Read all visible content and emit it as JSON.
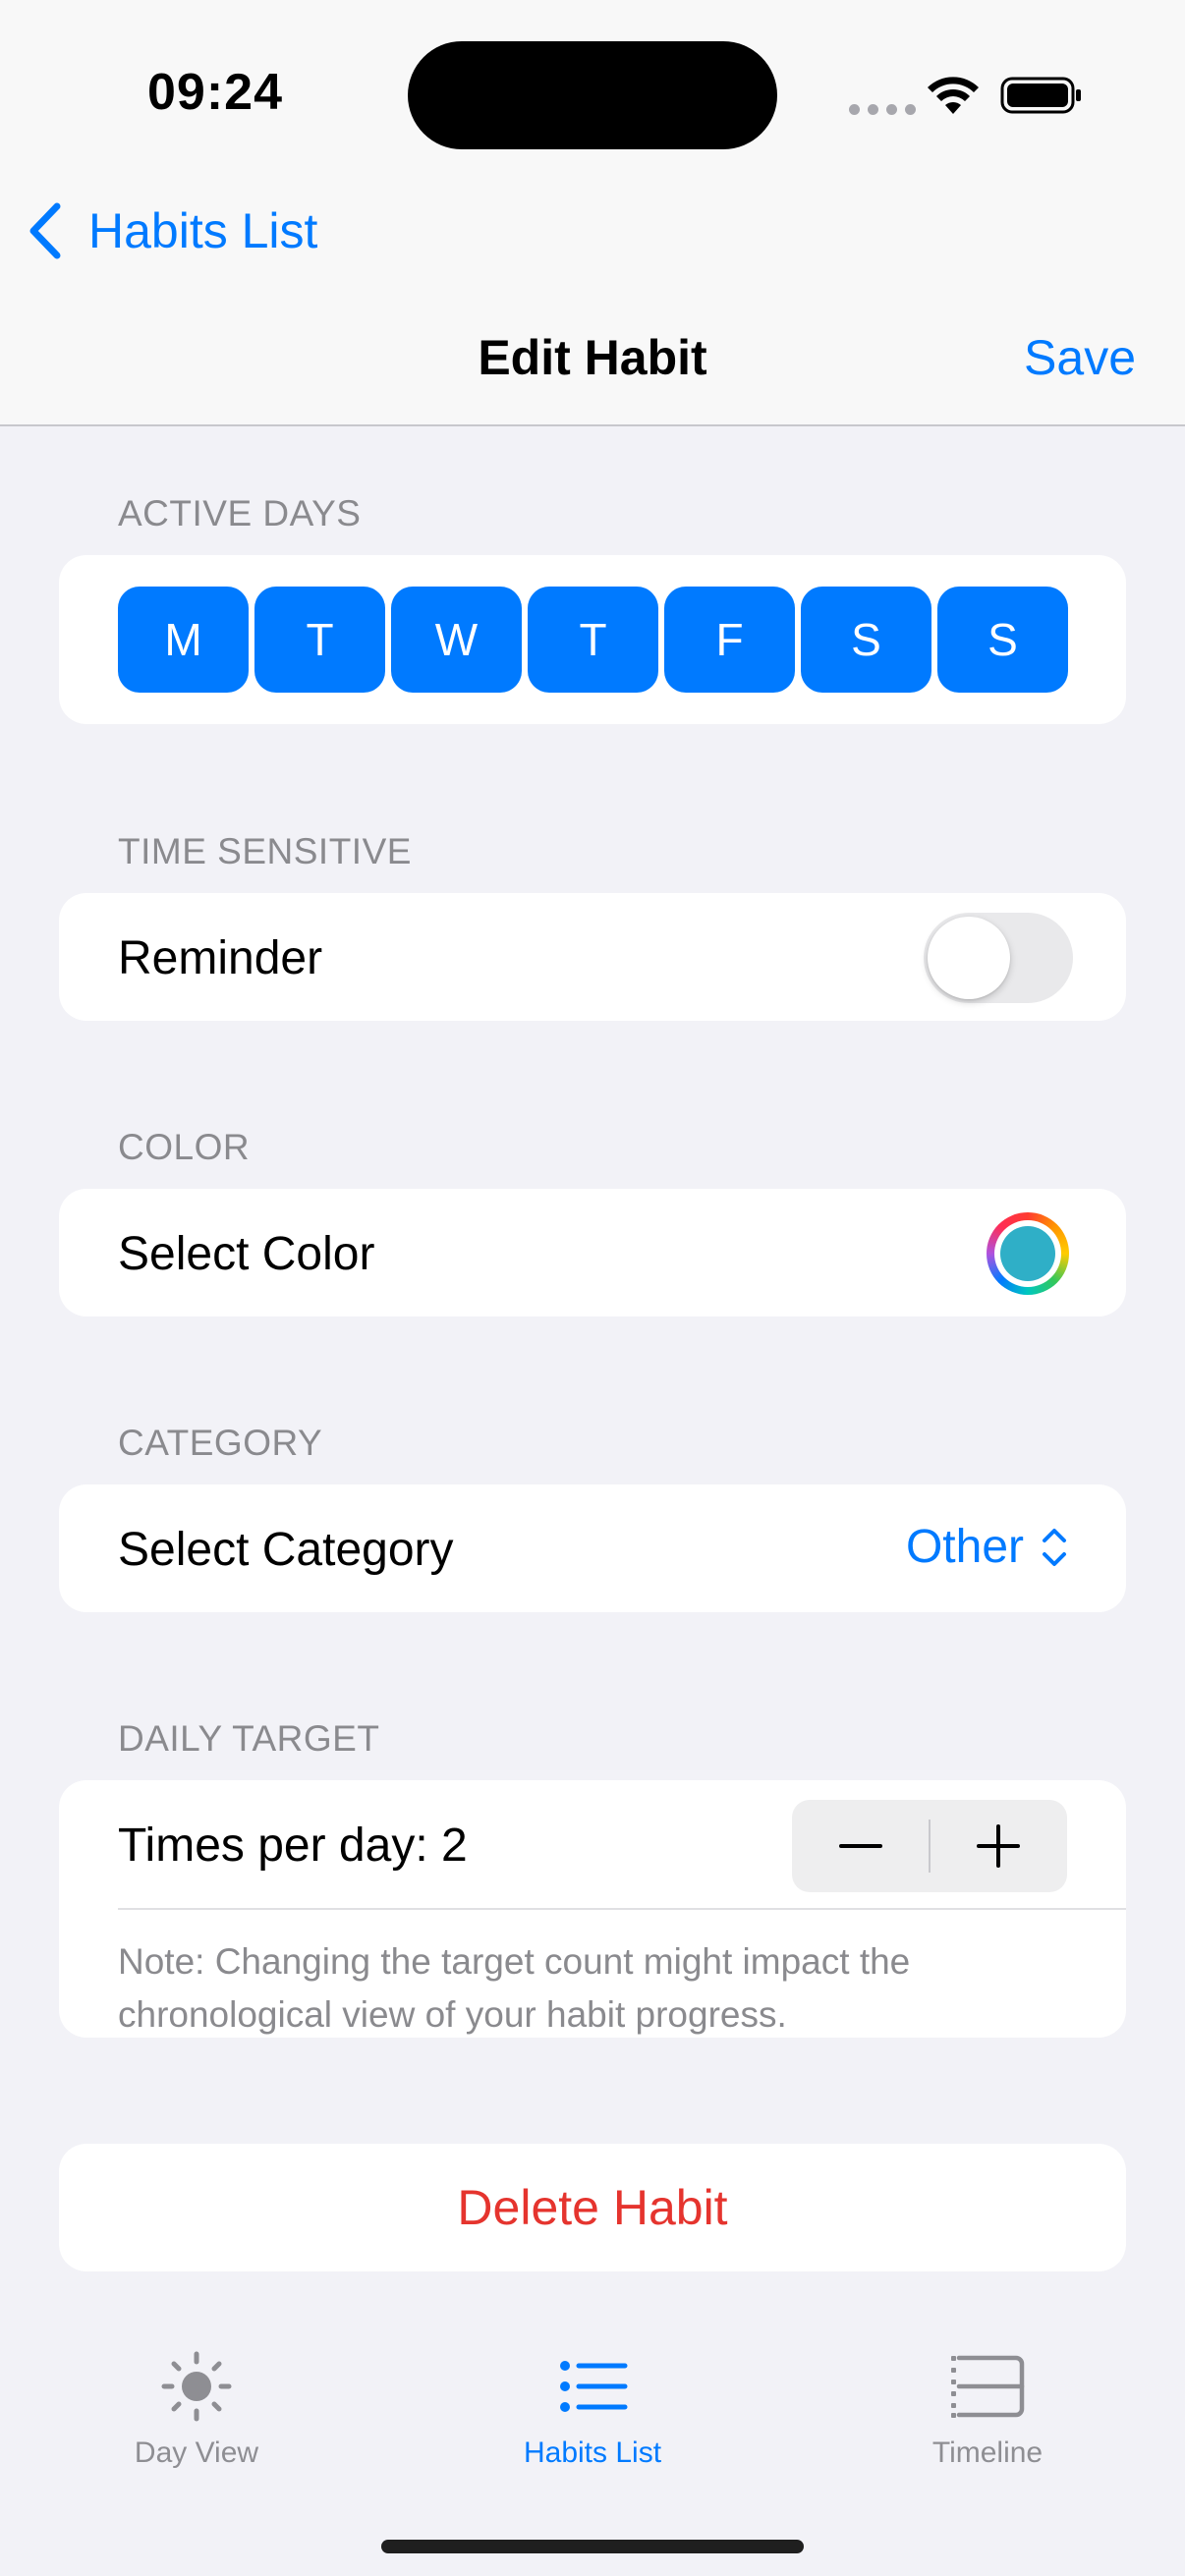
{
  "status_bar": {
    "time": "09:24"
  },
  "nav": {
    "back_label": "Habits List",
    "title": "Edit Habit",
    "save_label": "Save"
  },
  "sections": {
    "active_days": {
      "label": "ACTIVE DAYS",
      "days": [
        "M",
        "T",
        "W",
        "T",
        "F",
        "S",
        "S"
      ]
    },
    "time_sensitive": {
      "label": "TIME SENSITIVE",
      "row_label": "Reminder",
      "toggle_on": false
    },
    "color": {
      "label": "COLOR",
      "row_label": "Select Color",
      "selected_color": "#2FAFC7"
    },
    "category": {
      "label": "CATEGORY",
      "row_label": "Select Category",
      "value": "Other"
    },
    "daily_target": {
      "label": "DAILY TARGET",
      "row_label": "Times per day: 2",
      "note": "Note: Changing the target count might impact the chronological view of your habit progress."
    }
  },
  "delete_label": "Delete Habit",
  "tab_bar": {
    "items": [
      {
        "label": "Day View",
        "icon": "sun-icon",
        "active": false
      },
      {
        "label": "Habits List",
        "icon": "list-icon",
        "active": true
      },
      {
        "label": "Timeline",
        "icon": "timeline-icon",
        "active": false
      }
    ]
  },
  "colors": {
    "accent": "#007AFF",
    "destructive": "#E5342E",
    "background": "#F2F2F7"
  }
}
